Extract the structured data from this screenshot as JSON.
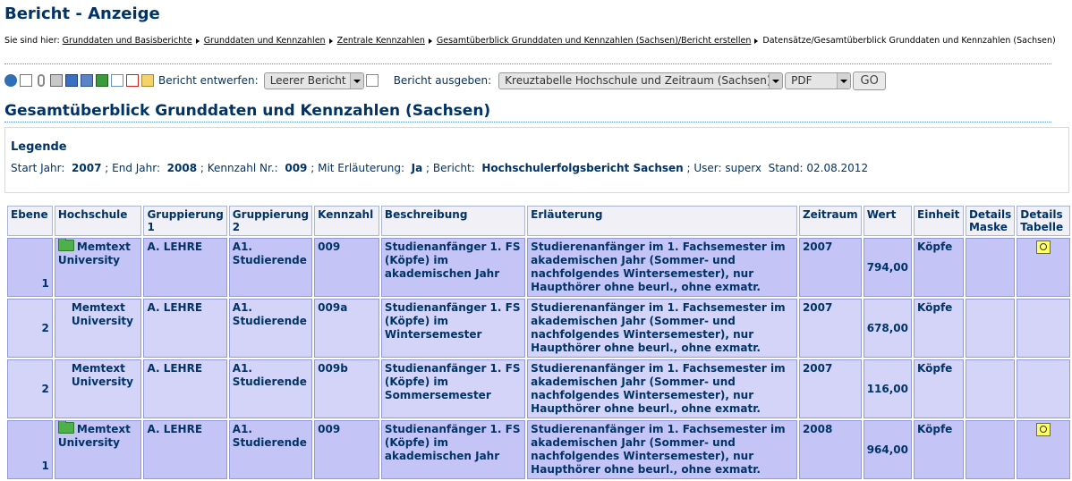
{
  "page": {
    "title": "Bericht - Anzeige"
  },
  "breadcrumb": {
    "prefix": "Sie sind hier:",
    "links": [
      "Grunddaten und Basisberichte",
      "Grunddaten und Kennzahlen",
      "Zentrale Kennzahlen",
      "Gesamtüberblick Grunddaten und Kennzahlen (Sachsen)/Bericht erstellen"
    ],
    "current": "Datensätze/Gesamtüberblick Grunddaten und Kennzahlen (Sachsen)"
  },
  "toolbar": {
    "icons": [
      "info-icon",
      "document-icon",
      "paperclip-icon",
      "print-icon",
      "save-icon",
      "html-icon",
      "excel-icon",
      "export-icon",
      "pdf-icon",
      "edit-icon"
    ],
    "entwerfen_label": "Bericht entwerfen:",
    "entwerfen_value": "Leerer Bericht (",
    "ausgeben_label": "Bericht ausgeben:",
    "ausgeben_value": "Kreuztabelle Hochschule und Zeitraum (Sachsen) (",
    "format_value": "PDF",
    "go_label": "GO"
  },
  "report": {
    "heading": "Gesamtüberblick Grunddaten und Kennzahlen (Sachsen)"
  },
  "legend": {
    "title": "Legende",
    "start_label": "Start Jahr:",
    "start_value": "2007",
    "end_label": "; End Jahr:",
    "end_value": "2008",
    "kennzahl_label": "; Kennzahl Nr.:",
    "kennzahl_value": "009",
    "erl_label": "; Mit Erläuterung:",
    "erl_value": "Ja",
    "bericht_label": "; Bericht:",
    "bericht_value": "Hochschulerfolgsbericht Sachsen",
    "user_text": "; User: superx",
    "stand_text": "Stand: 02.08.2012"
  },
  "table": {
    "headers": [
      "Ebene",
      "Hochschule",
      "Gruppierung 1",
      "Gruppierung 2",
      "Kennzahl",
      "Beschreibung",
      "Erläuterung",
      "Zeitraum",
      "Wert",
      "Einheit",
      "Details Maske",
      "Details Tabelle"
    ],
    "rows": [
      {
        "ebene": "1",
        "hochschule": "Memtext University",
        "folder": true,
        "gruppierung1": "A. LEHRE",
        "gruppierung2": "A1. Studierende",
        "kennzahl": "009",
        "beschreibung": "Studienanfänger 1. FS (Köpfe) im akademischen Jahr",
        "erlaeuterung": "Studierenanfänger im 1. Fachsemester im akademischen Jahr (Sommer- und nachfolgendes Wintersemester), nur Haupthörer ohne beurl., ohne exmatr.",
        "zeitraum": "2007",
        "wert": "794,00",
        "einheit": "Köpfe",
        "details_tabelle_icon": true
      },
      {
        "ebene": "2",
        "hochschule": "Memtext University",
        "folder": false,
        "gruppierung1": "A. LEHRE",
        "gruppierung2": "A1. Studierende",
        "kennzahl": "009a",
        "beschreibung": "Studienanfänger 1. FS (Köpfe) im Wintersemester",
        "erlaeuterung": "Studierenanfänger im 1. Fachsemester im akademischen Jahr (Sommer- und nachfolgendes Wintersemester), nur Haupthörer ohne beurl., ohne exmatr.",
        "zeitraum": "2007",
        "wert": "678,00",
        "einheit": "Köpfe",
        "details_tabelle_icon": false
      },
      {
        "ebene": "2",
        "hochschule": "Memtext University",
        "folder": false,
        "gruppierung1": "A. LEHRE",
        "gruppierung2": "A1. Studierende",
        "kennzahl": "009b",
        "beschreibung": "Studienanfänger 1. FS (Köpfe) im Sommersemester",
        "erlaeuterung": "Studierenanfänger im 1. Fachsemester im akademischen Jahr (Sommer- und nachfolgendes Wintersemester), nur Haupthörer ohne beurl., ohne exmatr.",
        "zeitraum": "2007",
        "wert": "116,00",
        "einheit": "Köpfe",
        "details_tabelle_icon": false
      },
      {
        "ebene": "1",
        "hochschule": "Memtext University",
        "folder": true,
        "gruppierung1": "A. LEHRE",
        "gruppierung2": "A1. Studierende",
        "kennzahl": "009",
        "beschreibung": "Studienanfänger 1. FS (Köpfe) im akademischen Jahr",
        "erlaeuterung": "Studierenanfänger im 1. Fachsemester im akademischen Jahr (Sommer- und nachfolgendes Wintersemester), nur Haupthörer ohne beurl., ohne exmatr.",
        "zeitraum": "2008",
        "wert": "964,00",
        "einheit": "Köpfe",
        "details_tabelle_icon": true
      }
    ]
  }
}
